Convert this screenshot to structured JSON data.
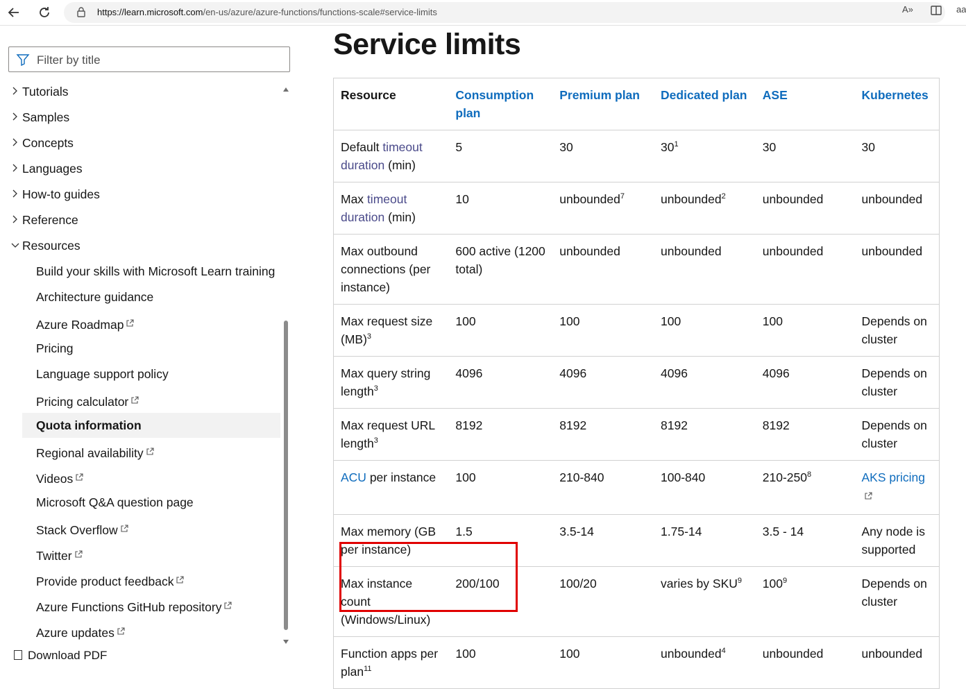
{
  "browser": {
    "url_domain": "https://learn.microsoft.com",
    "url_path": "/en-us/azure/azure-functions/functions-scale#service-limits",
    "read_aloud_label": "A»",
    "extra_label": "aa"
  },
  "sidebar": {
    "filter_placeholder": "Filter by title",
    "top_items": [
      "Tutorials",
      "Samples",
      "Concepts",
      "Languages",
      "How-to guides",
      "Reference",
      "Resources"
    ],
    "resource_items": [
      {
        "label": "Build your skills with Microsoft Learn training",
        "external": false
      },
      {
        "label": "Architecture guidance",
        "external": false
      },
      {
        "label": "Azure Roadmap",
        "external": true
      },
      {
        "label": "Pricing",
        "external": false
      },
      {
        "label": "Language support policy",
        "external": false
      },
      {
        "label": "Pricing calculator",
        "external": true
      },
      {
        "label": "Quota information",
        "external": false,
        "active": true
      },
      {
        "label": "Regional availability",
        "external": true
      },
      {
        "label": "Videos",
        "external": true
      },
      {
        "label": "Microsoft Q&A question page",
        "external": false
      },
      {
        "label": "Stack Overflow",
        "external": true
      },
      {
        "label": "Twitter",
        "external": true
      },
      {
        "label": "Provide product feedback",
        "external": true
      },
      {
        "label": "Azure Functions GitHub repository",
        "external": true
      },
      {
        "label": "Azure updates",
        "external": true
      }
    ],
    "download_pdf": "Download PDF"
  },
  "main": {
    "title": "Service limits",
    "table": {
      "headers": [
        "Resource",
        "Consumption plan",
        "Premium plan",
        "Dedicated plan",
        "ASE",
        "Kubernetes"
      ],
      "rows": [
        {
          "resource": {
            "pre": "Default ",
            "link": "timeout duration",
            "post": " (min)"
          },
          "cells": [
            {
              "t": "5"
            },
            {
              "t": "30"
            },
            {
              "t": "30",
              "sup": "1"
            },
            {
              "t": "30"
            },
            {
              "t": "30"
            }
          ]
        },
        {
          "resource": {
            "pre": "Max ",
            "link": "timeout duration",
            "post": " (min)"
          },
          "cells": [
            {
              "t": "10"
            },
            {
              "t": "unbounded",
              "sup": "7"
            },
            {
              "t": "unbounded",
              "sup": "2"
            },
            {
              "t": "unbounded"
            },
            {
              "t": "unbounded"
            }
          ]
        },
        {
          "resource": {
            "pre": "Max outbound connections (per instance)"
          },
          "cells": [
            {
              "t": "600 active (1200 total)"
            },
            {
              "t": "unbounded"
            },
            {
              "t": "unbounded"
            },
            {
              "t": "unbounded"
            },
            {
              "t": "unbounded"
            }
          ]
        },
        {
          "resource": {
            "pre": "Max request size (MB)",
            "sup": "3"
          },
          "cells": [
            {
              "t": "100"
            },
            {
              "t": "100"
            },
            {
              "t": "100"
            },
            {
              "t": "100"
            },
            {
              "t": "Depends on cluster"
            }
          ]
        },
        {
          "resource": {
            "pre": "Max query string length",
            "sup": "3"
          },
          "cells": [
            {
              "t": "4096"
            },
            {
              "t": "4096"
            },
            {
              "t": "4096"
            },
            {
              "t": "4096"
            },
            {
              "t": "Depends on cluster"
            }
          ]
        },
        {
          "resource": {
            "pre": "Max request URL length",
            "sup": "3"
          },
          "cells": [
            {
              "t": "8192"
            },
            {
              "t": "8192"
            },
            {
              "t": "8192"
            },
            {
              "t": "8192"
            },
            {
              "t": "Depends on cluster"
            }
          ]
        },
        {
          "resource": {
            "link_first": "ACU",
            "post": " per instance"
          },
          "cells": [
            {
              "t": "100"
            },
            {
              "t": "210-840"
            },
            {
              "t": "100-840"
            },
            {
              "t": "210-250",
              "sup": "8"
            },
            {
              "link": "AKS pricing",
              "external": true
            }
          ]
        },
        {
          "resource": {
            "pre": "Max memory (GB per instance)"
          },
          "cells": [
            {
              "t": "1.5"
            },
            {
              "t": "3.5-14"
            },
            {
              "t": "1.75-14"
            },
            {
              "t": "3.5 - 14"
            },
            {
              "t": "Any node is supported"
            }
          ]
        },
        {
          "resource": {
            "pre": "Max instance count (Windows/Linux)"
          },
          "cells": [
            {
              "t": "200/100"
            },
            {
              "t": "100/20"
            },
            {
              "t": "varies by SKU",
              "sup": "9"
            },
            {
              "t": "100",
              "sup": "9"
            },
            {
              "t": "Depends on cluster"
            }
          ]
        },
        {
          "resource": {
            "pre": "Function apps per plan",
            "sup": "11"
          },
          "cells": [
            {
              "t": "100"
            },
            {
              "t": "100"
            },
            {
              "t": "unbounded",
              "sup": "4"
            },
            {
              "t": "unbounded"
            },
            {
              "t": "unbounded"
            }
          ]
        }
      ]
    },
    "highlight_color": "#e00000",
    "link_color": "#0f6cbd"
  }
}
